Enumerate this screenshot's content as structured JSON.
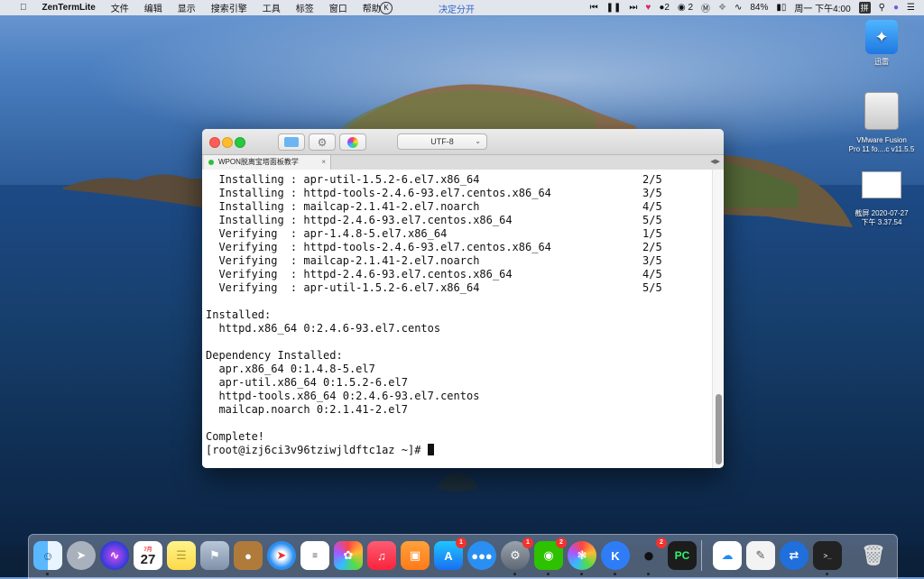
{
  "menubar": {
    "app_name": "ZenTermLite",
    "items": [
      "文件",
      "编辑",
      "显示",
      "搜索引擎",
      "工具",
      "标签",
      "窗口",
      "帮助"
    ],
    "center_label": "决定分开",
    "wechat_count": "2",
    "contacts_count": "2",
    "battery": "84%",
    "datetime": "周一 下午4:00",
    "input_method": "拼"
  },
  "desktop": {
    "icons": [
      {
        "label": "迅雷"
      },
      {
        "label_line1": "VMware Fusion",
        "label_line2": "Pro 11 fo....c v11.5.5"
      },
      {
        "label_line1": "截屏 2020-07-27",
        "label_line2": "下午 3.37.54"
      }
    ]
  },
  "terminal": {
    "encoding": "UTF-8",
    "tab_title": "WPON脱离宝塔面板教学",
    "tab_close": "×",
    "lines": [
      "  Installing : apr-util-1.5.2-6.el7.x86_64                         2/5",
      "  Installing : httpd-tools-2.4.6-93.el7.centos.x86_64              3/5",
      "  Installing : mailcap-2.1.41-2.el7.noarch                         4/5",
      "  Installing : httpd-2.4.6-93.el7.centos.x86_64                    5/5",
      "  Verifying  : apr-1.4.8-5.el7.x86_64                              1/5",
      "  Verifying  : httpd-tools-2.4.6-93.el7.centos.x86_64              2/5",
      "  Verifying  : mailcap-2.1.41-2.el7.noarch                         3/5",
      "  Verifying  : httpd-2.4.6-93.el7.centos.x86_64                    4/5",
      "  Verifying  : apr-util-1.5.2-6.el7.x86_64                         5/5",
      "",
      "Installed:",
      "  httpd.x86_64 0:2.4.6-93.el7.centos",
      "",
      "Dependency Installed:",
      "  apr.x86_64 0:1.4.8-5.el7",
      "  apr-util.x86_64 0:1.5.2-6.el7",
      "  httpd-tools.x86_64 0:2.4.6-93.el7.centos",
      "  mailcap.noarch 0:2.1.41-2.el7",
      "",
      "Complete!"
    ],
    "prompt": "[root@izj6ci3v96tziwjldftc1az ~]# "
  },
  "dock": {
    "calendar_month": "7月",
    "calendar_day": "27",
    "badges": {
      "appstore": "1",
      "sysprefs": "1",
      "wechat": "2",
      "qq": "2"
    },
    "pycharm_label": "PC"
  }
}
